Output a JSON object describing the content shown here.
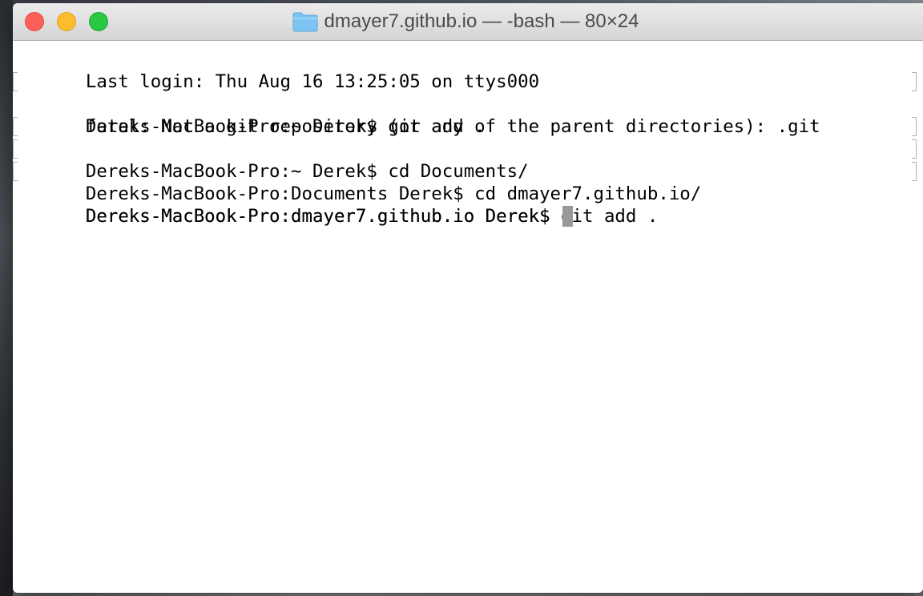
{
  "window": {
    "title": "dmayer7.github.io — -bash — 80×24",
    "folder_icon": "folder-icon",
    "traffic_lights": {
      "close_color": "#fc5f57",
      "minimize_color": "#fdbc2e",
      "maximize_color": "#28c840"
    }
  },
  "terminal": {
    "lines": [
      {
        "text": "Last login: Thu Aug 16 13:25:05 on ttys000",
        "marked": false
      },
      {
        "text": "Dereks-MacBook-Pro:~ Derek$ git add .",
        "marked": true
      },
      {
        "text": "fatal: Not a git repository (or any of the parent directories): .git",
        "marked": false
      },
      {
        "text": "Dereks-MacBook-Pro:~ Derek$ cd Documents/",
        "marked": true
      },
      {
        "text": "Dereks-MacBook-Pro:Documents Derek$ cd dmayer7.github.io/",
        "marked": true
      },
      {
        "text": "Dereks-MacBook-Pro:dmayer7.github.io Derek$ git add .",
        "marked": true
      }
    ],
    "prompt": "Dereks-MacBook-Pro:dmayer7.github.io Derek$ ",
    "text_color": "#000000",
    "background_color": "#ffffff",
    "cursor_color": "#999999"
  }
}
